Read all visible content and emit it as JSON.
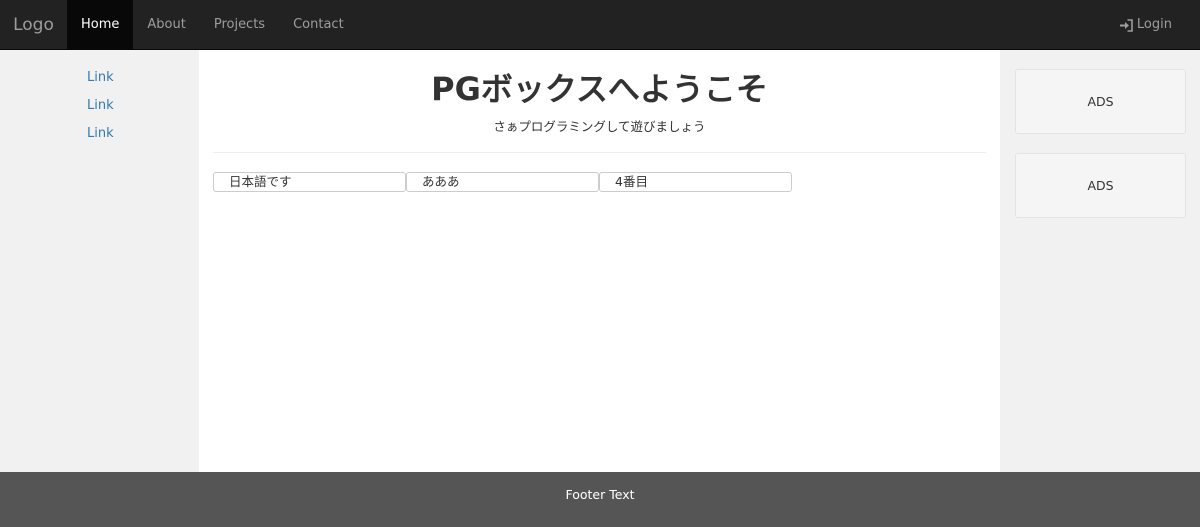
{
  "navbar": {
    "brand": "Logo",
    "items": [
      {
        "label": "Home",
        "active": true
      },
      {
        "label": "About",
        "active": false
      },
      {
        "label": "Projects",
        "active": false
      },
      {
        "label": "Contact",
        "active": false
      }
    ],
    "login_label": "Login",
    "login_icon": "log-in-icon"
  },
  "sidenav": {
    "links": [
      "Link",
      "Link",
      "Link"
    ]
  },
  "main": {
    "title": "PGボックスへようこそ",
    "subtitle": "さぁプログラミングして遊びましょう",
    "boxes": [
      "日本語です",
      "あああ",
      "4番目"
    ]
  },
  "ads": [
    "ADS",
    "ADS"
  ],
  "footer": {
    "text": "Footer Text"
  },
  "colors": {
    "navbar_bg": "#222222",
    "link": "#337ab7",
    "footer_bg": "#555555",
    "side_bg": "#f1f1f1"
  }
}
